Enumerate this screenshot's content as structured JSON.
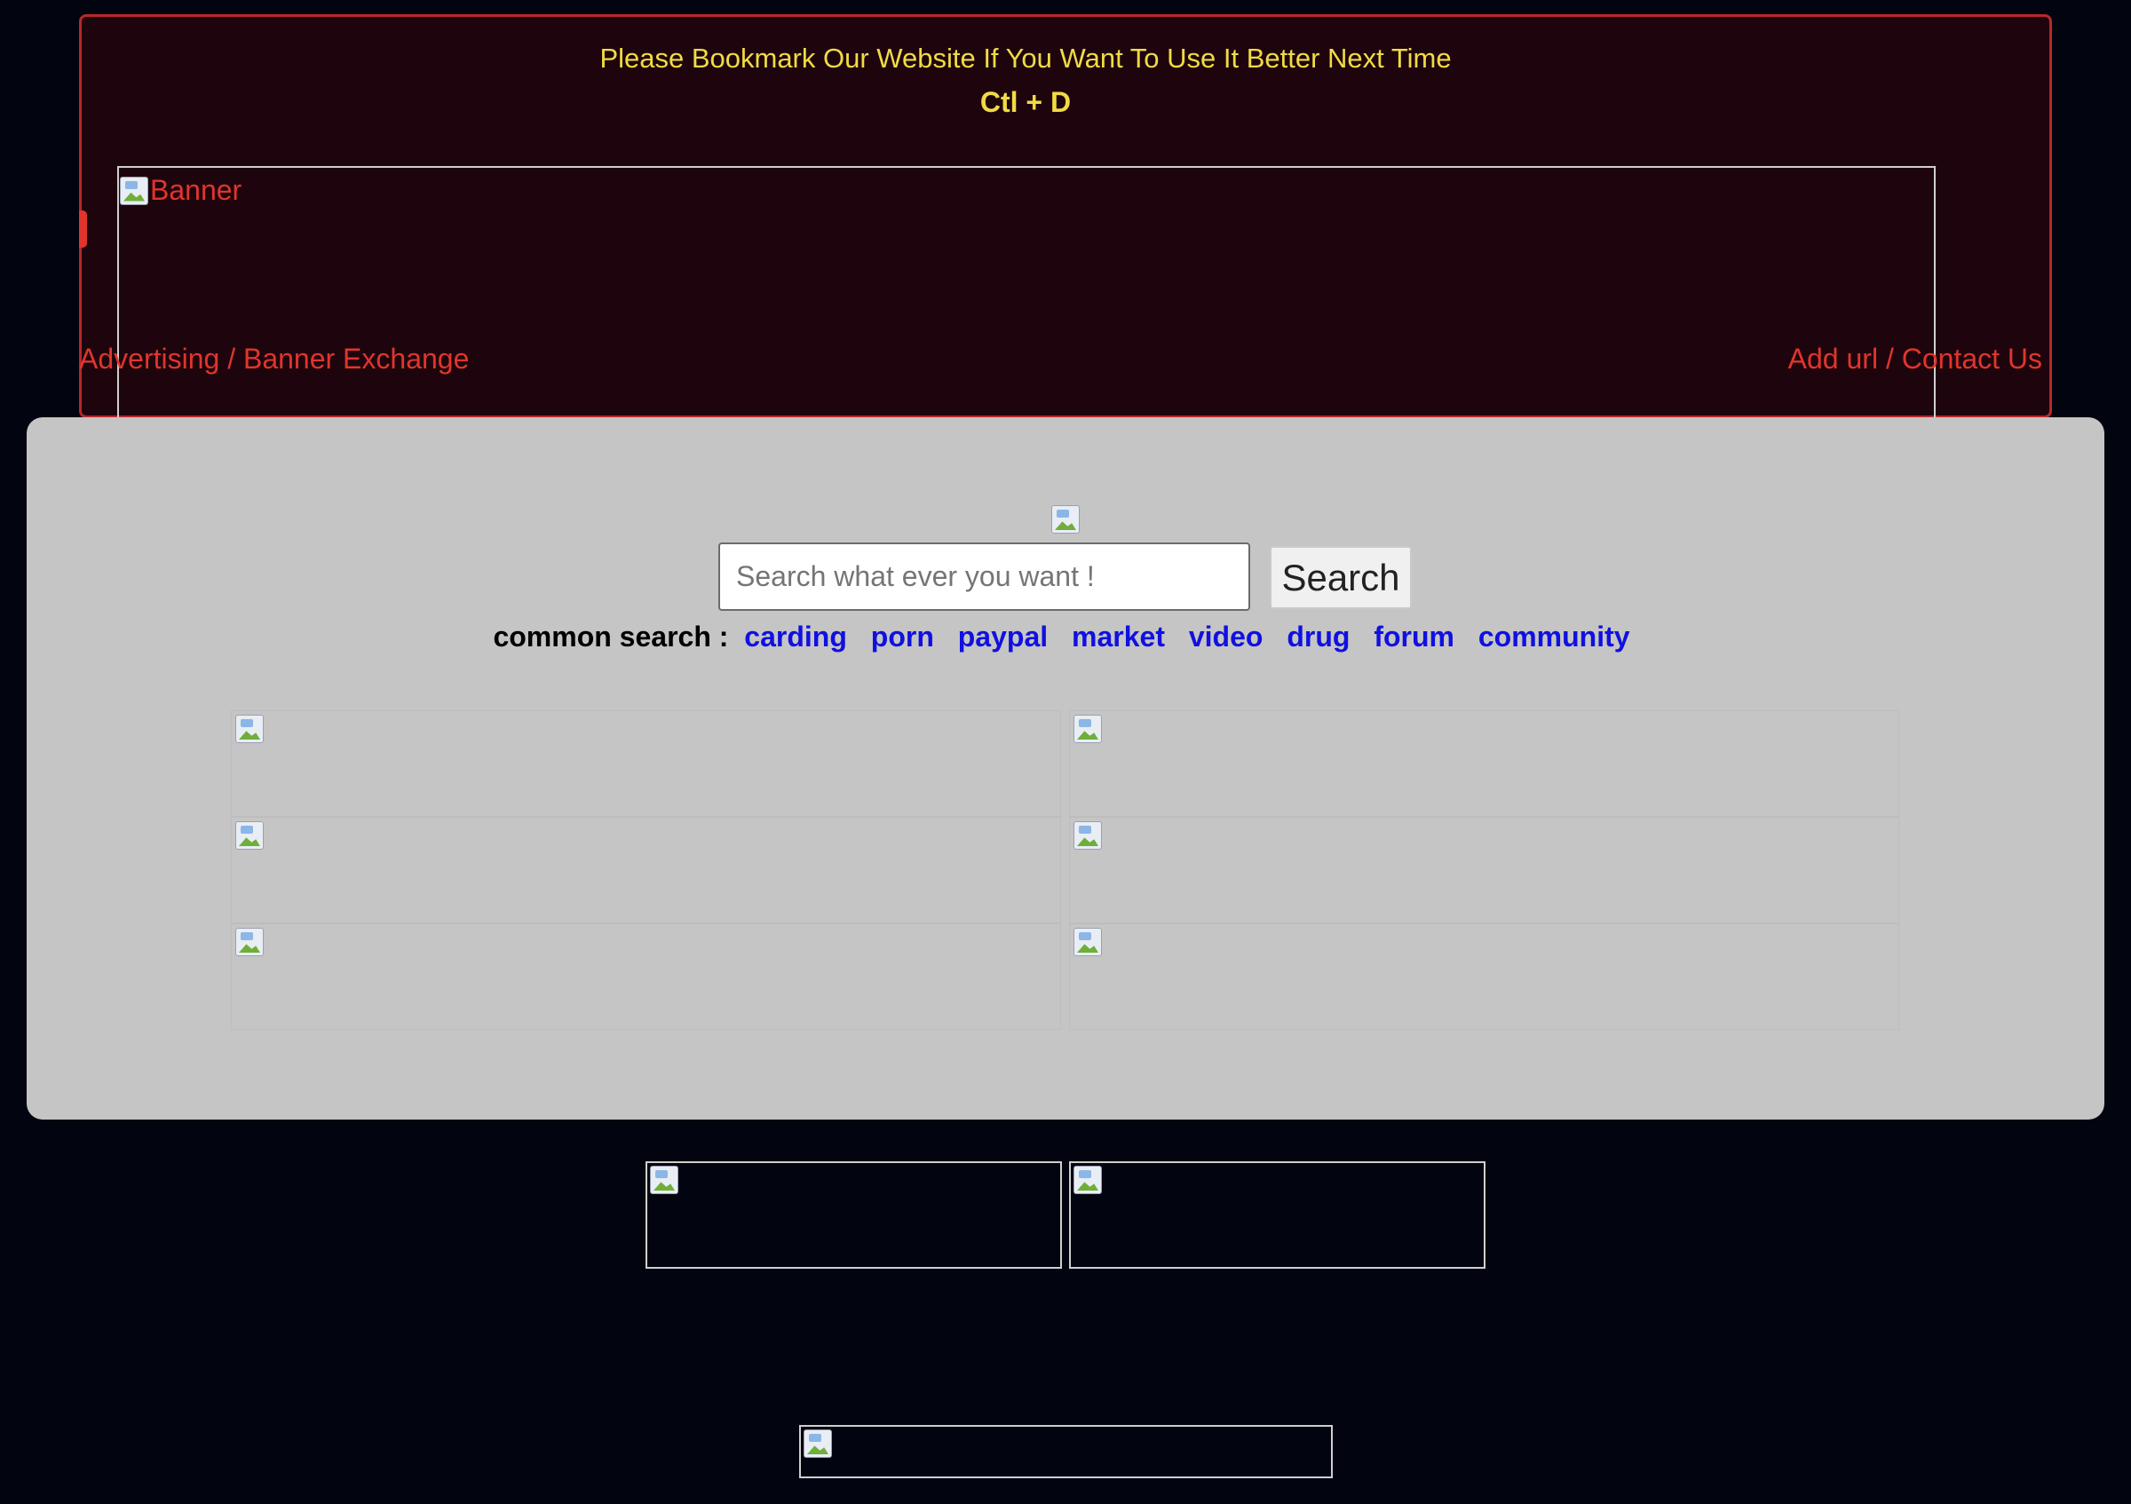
{
  "notice": {
    "line1": "Please Bookmark Our Website If You Want To Use It Better Next Time",
    "line2": "Ctl + D"
  },
  "banner": {
    "alt": "Banner"
  },
  "links": {
    "left": "Advertising / Banner Exchange",
    "right": "Add url / Contact Us"
  },
  "search": {
    "placeholder": "Search what ever you want !",
    "button_label": "Search"
  },
  "common_search": {
    "label": "common search :",
    "terms": [
      "carding",
      "porn",
      "paypal",
      "market",
      "video",
      "drug",
      "forum",
      "community"
    ]
  },
  "colors": {
    "background": "#020410",
    "notice_panel": "#1e050d",
    "accent_red": "#e0352c",
    "notice_yellow": "#f1db44",
    "search_panel": "#c5c5c5",
    "link_blue": "#1010e0"
  },
  "icons": {
    "broken_image": "broken-image-icon"
  }
}
